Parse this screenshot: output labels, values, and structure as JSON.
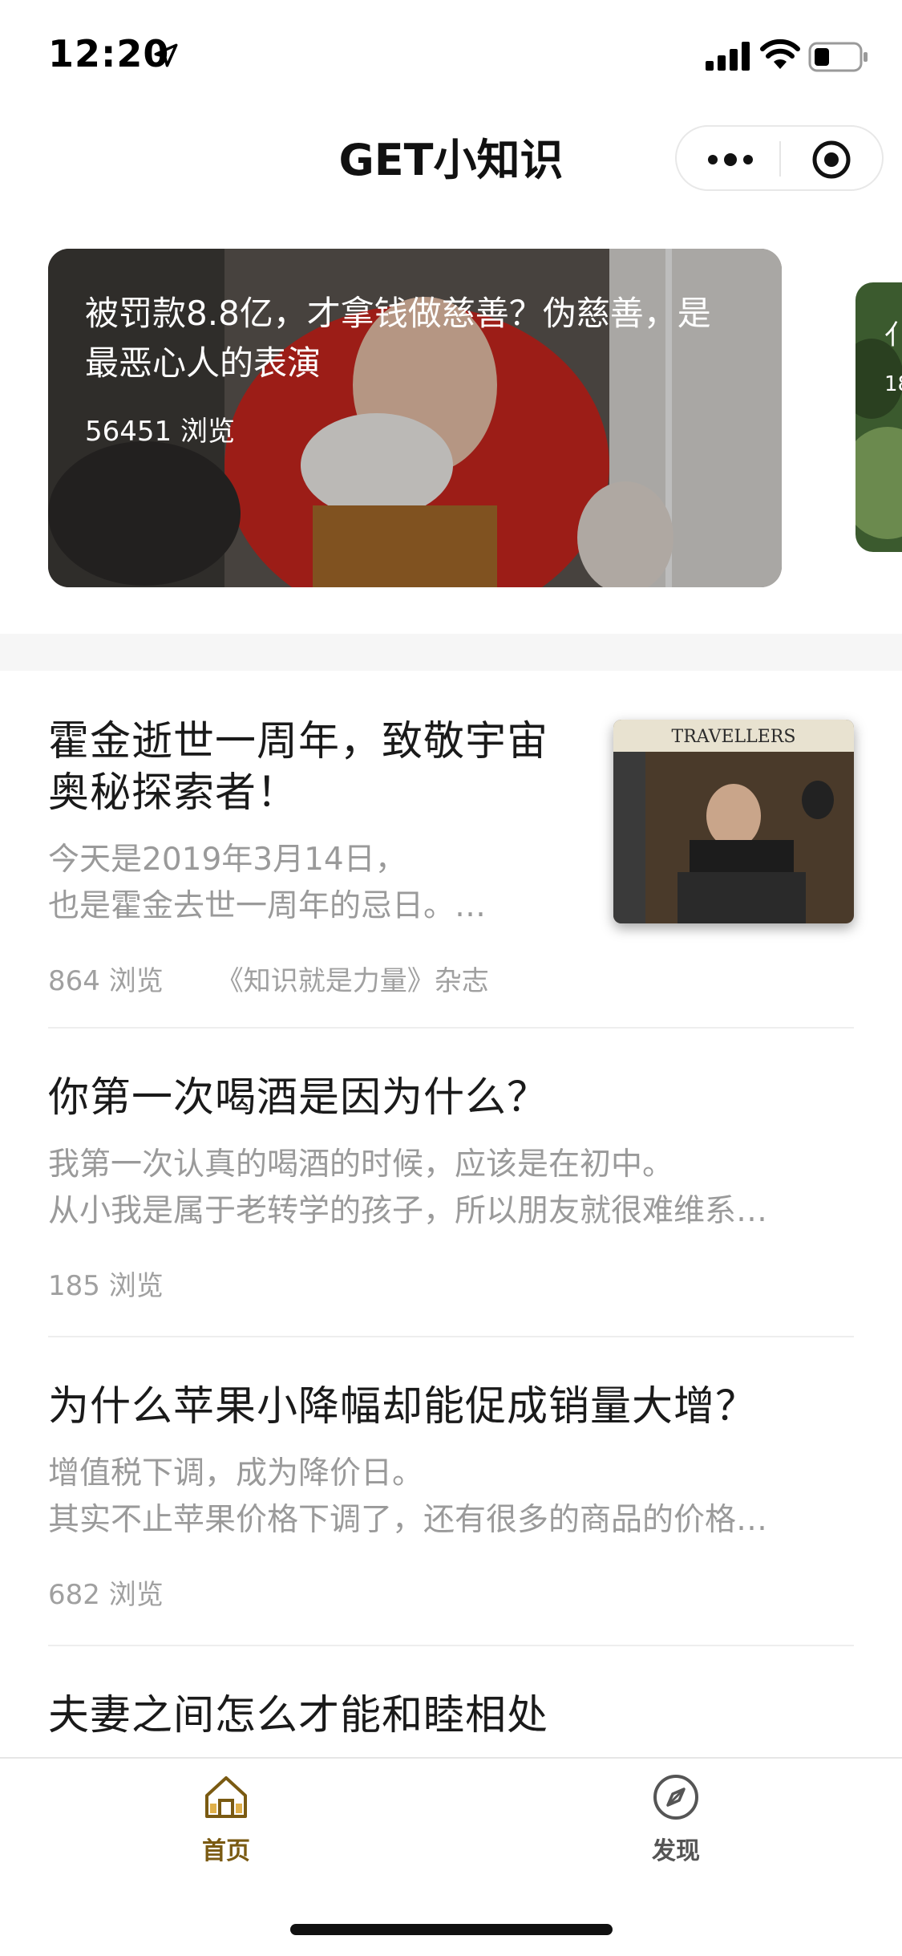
{
  "status_bar": {
    "time": "12:20"
  },
  "nav": {
    "title": "GET小知识"
  },
  "carousel": {
    "active": {
      "title": "被罚款8.8亿，才拿钱做慈善？伪慈善，是最恶心人的表演",
      "views": "56451 浏览"
    },
    "next": {
      "title_fragment": "亻",
      "views_fragment": "18"
    }
  },
  "articles": [
    {
      "title": "霍金逝世一周年，致敬宇宙奥秘探索者！",
      "summary_lines": [
        "今天是2019年3月14日，",
        "也是霍金去世一周年的忌日。…"
      ],
      "views": "864 浏览",
      "source": "《知识就是力量》杂志",
      "thumbnail_text": "TRAVELLERS"
    },
    {
      "title": "你第一次喝酒是因为什么？",
      "summary_lines": [
        "我第一次认真的喝酒的时候，应该是在初中。",
        "从小我是属于老转学的孩子，所以朋友就很难维系…"
      ],
      "views": "185 浏览"
    },
    {
      "title": "为什么苹果小降幅却能促成销量大增？",
      "summary_lines": [
        "增值税下调，成为降价日。",
        "其实不止苹果价格下调了，还有很多的商品的价格…"
      ],
      "views": "682 浏览"
    },
    {
      "title": "夫妻之间怎么才能和睦相处"
    }
  ],
  "tabbar": {
    "tabs": [
      {
        "label": "首页",
        "icon": "home-icon",
        "active": true
      },
      {
        "label": "发现",
        "icon": "compass-icon",
        "active": false
      }
    ],
    "active_color": "#7a5a12",
    "inactive_color": "#555555"
  }
}
